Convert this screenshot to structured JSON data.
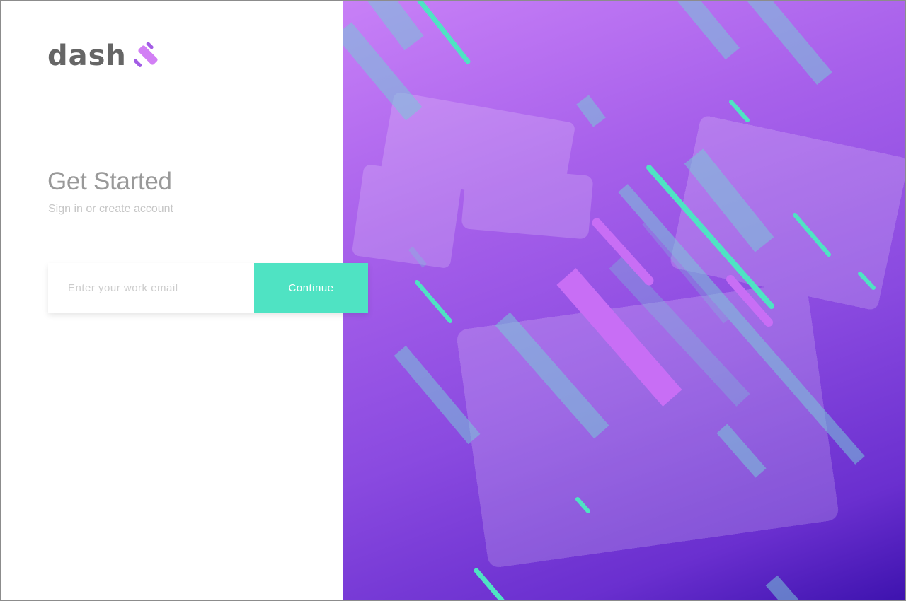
{
  "brand": {
    "name": "dash",
    "logo_icon": "dash-logo-mark-icon",
    "accent_color": "#d27ff5",
    "accent_dark": "#a35de5"
  },
  "header": {
    "title": "Get Started",
    "subtitle": "Sign in or create account"
  },
  "form": {
    "email_placeholder": "Enter your work email",
    "email_value": "",
    "continue_label": "Continue",
    "button_color": "#4fe3c3"
  },
  "hero": {
    "image_description_icon": "hero-illustration",
    "gradient_colors": [
      "#c880f7",
      "#a861eb",
      "#8a4ae0",
      "#6a2fcf",
      "#3d12ae"
    ],
    "stripe_colors": [
      "#4fe3c3",
      "#c86ef5",
      "#78c7d8"
    ]
  }
}
